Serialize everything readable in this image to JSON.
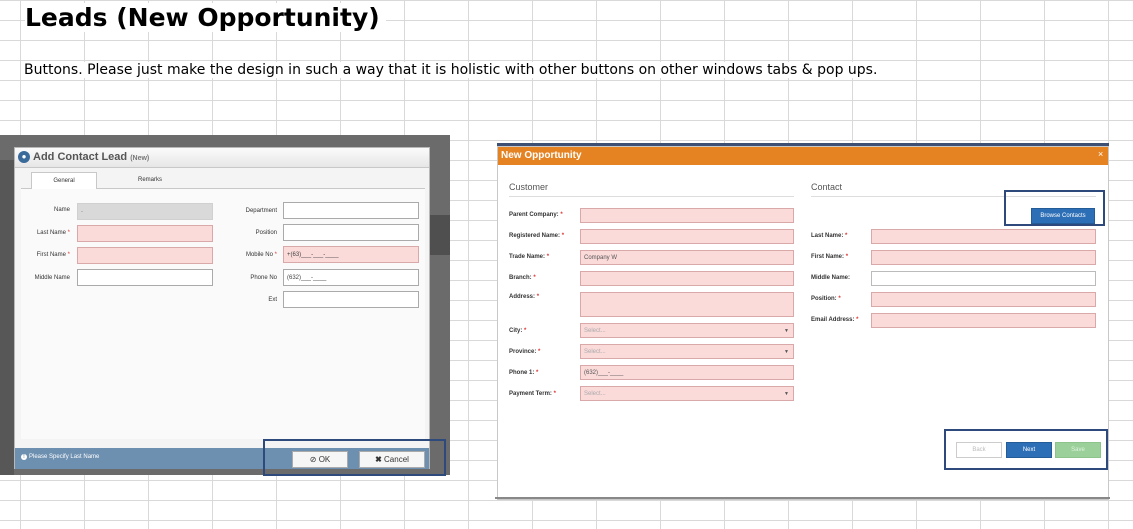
{
  "sheet": {
    "title": "Leads (New Opportunity)",
    "note": "Buttons. Please just make the design in such a way that it is holistic with other buttons on other windows tabs & pop ups."
  },
  "contact_dialog": {
    "title": "Add Contact Lead",
    "title_suffix": "(New)",
    "tabs": [
      "General",
      "Remarks"
    ],
    "left_fields": [
      {
        "label": "Name",
        "required": false,
        "value": "-",
        "style": "gray"
      },
      {
        "label": "Last Name",
        "required": true,
        "value": "",
        "style": "pink"
      },
      {
        "label": "First Name",
        "required": true,
        "value": "",
        "style": "pink"
      },
      {
        "label": "Middle Name",
        "required": false,
        "value": "",
        "style": "white"
      }
    ],
    "right_fields": [
      {
        "label": "Department",
        "required": false,
        "value": "",
        "style": "white"
      },
      {
        "label": "Position",
        "required": false,
        "value": "",
        "style": "white"
      },
      {
        "label": "Mobile No",
        "required": true,
        "value": "+(63)___-___-____",
        "style": "pink"
      },
      {
        "label": "Phone No",
        "required": false,
        "value": "(632)___-____",
        "style": "white"
      },
      {
        "label": "Ext",
        "required": false,
        "value": "",
        "style": "white"
      }
    ],
    "footer_message": "Please Specify Last Name",
    "ok_label": "OK",
    "cancel_label": "Cancel"
  },
  "opportunity_dialog": {
    "title": "New Opportunity",
    "close": "×",
    "customer_section": "Customer",
    "contact_section": "Contact",
    "browse_contacts": "Browse Contacts",
    "customer_fields": [
      {
        "label": "Parent Company:",
        "required": true,
        "value": "",
        "kind": "text"
      },
      {
        "label": "Registered Name:",
        "required": true,
        "value": "",
        "kind": "text"
      },
      {
        "label": "Trade Name:",
        "required": true,
        "value": "Company W",
        "kind": "text"
      },
      {
        "label": "Branch:",
        "required": true,
        "value": "",
        "kind": "text"
      },
      {
        "label": "Address:",
        "required": true,
        "value": "",
        "kind": "textarea"
      },
      {
        "label": "City:",
        "required": true,
        "value": "Select...",
        "kind": "select"
      },
      {
        "label": "Province:",
        "required": true,
        "value": "Select...",
        "kind": "select"
      },
      {
        "label": "Phone 1:",
        "required": true,
        "value": "(632)___-____",
        "kind": "text"
      },
      {
        "label": "Payment Term:",
        "required": true,
        "value": "Select...",
        "kind": "select"
      }
    ],
    "contact_fields": [
      {
        "label": "Last Name:",
        "required": true,
        "value": "",
        "style": "pink"
      },
      {
        "label": "First Name:",
        "required": true,
        "value": "",
        "style": "pink"
      },
      {
        "label": "Middle Name:",
        "required": false,
        "value": "",
        "style": "white"
      },
      {
        "label": "Position:",
        "required": true,
        "value": "",
        "style": "pink"
      },
      {
        "label": "Email Address:",
        "required": true,
        "value": "",
        "style": "pink"
      }
    ],
    "back_label": "Back",
    "next_label": "Next",
    "save_label": "Save"
  },
  "colors": {
    "accent_orange": "#e58323",
    "primary_blue": "#2d6fb6",
    "required_pink": "#fbdada",
    "highlight_box": "#2e4a7d"
  }
}
